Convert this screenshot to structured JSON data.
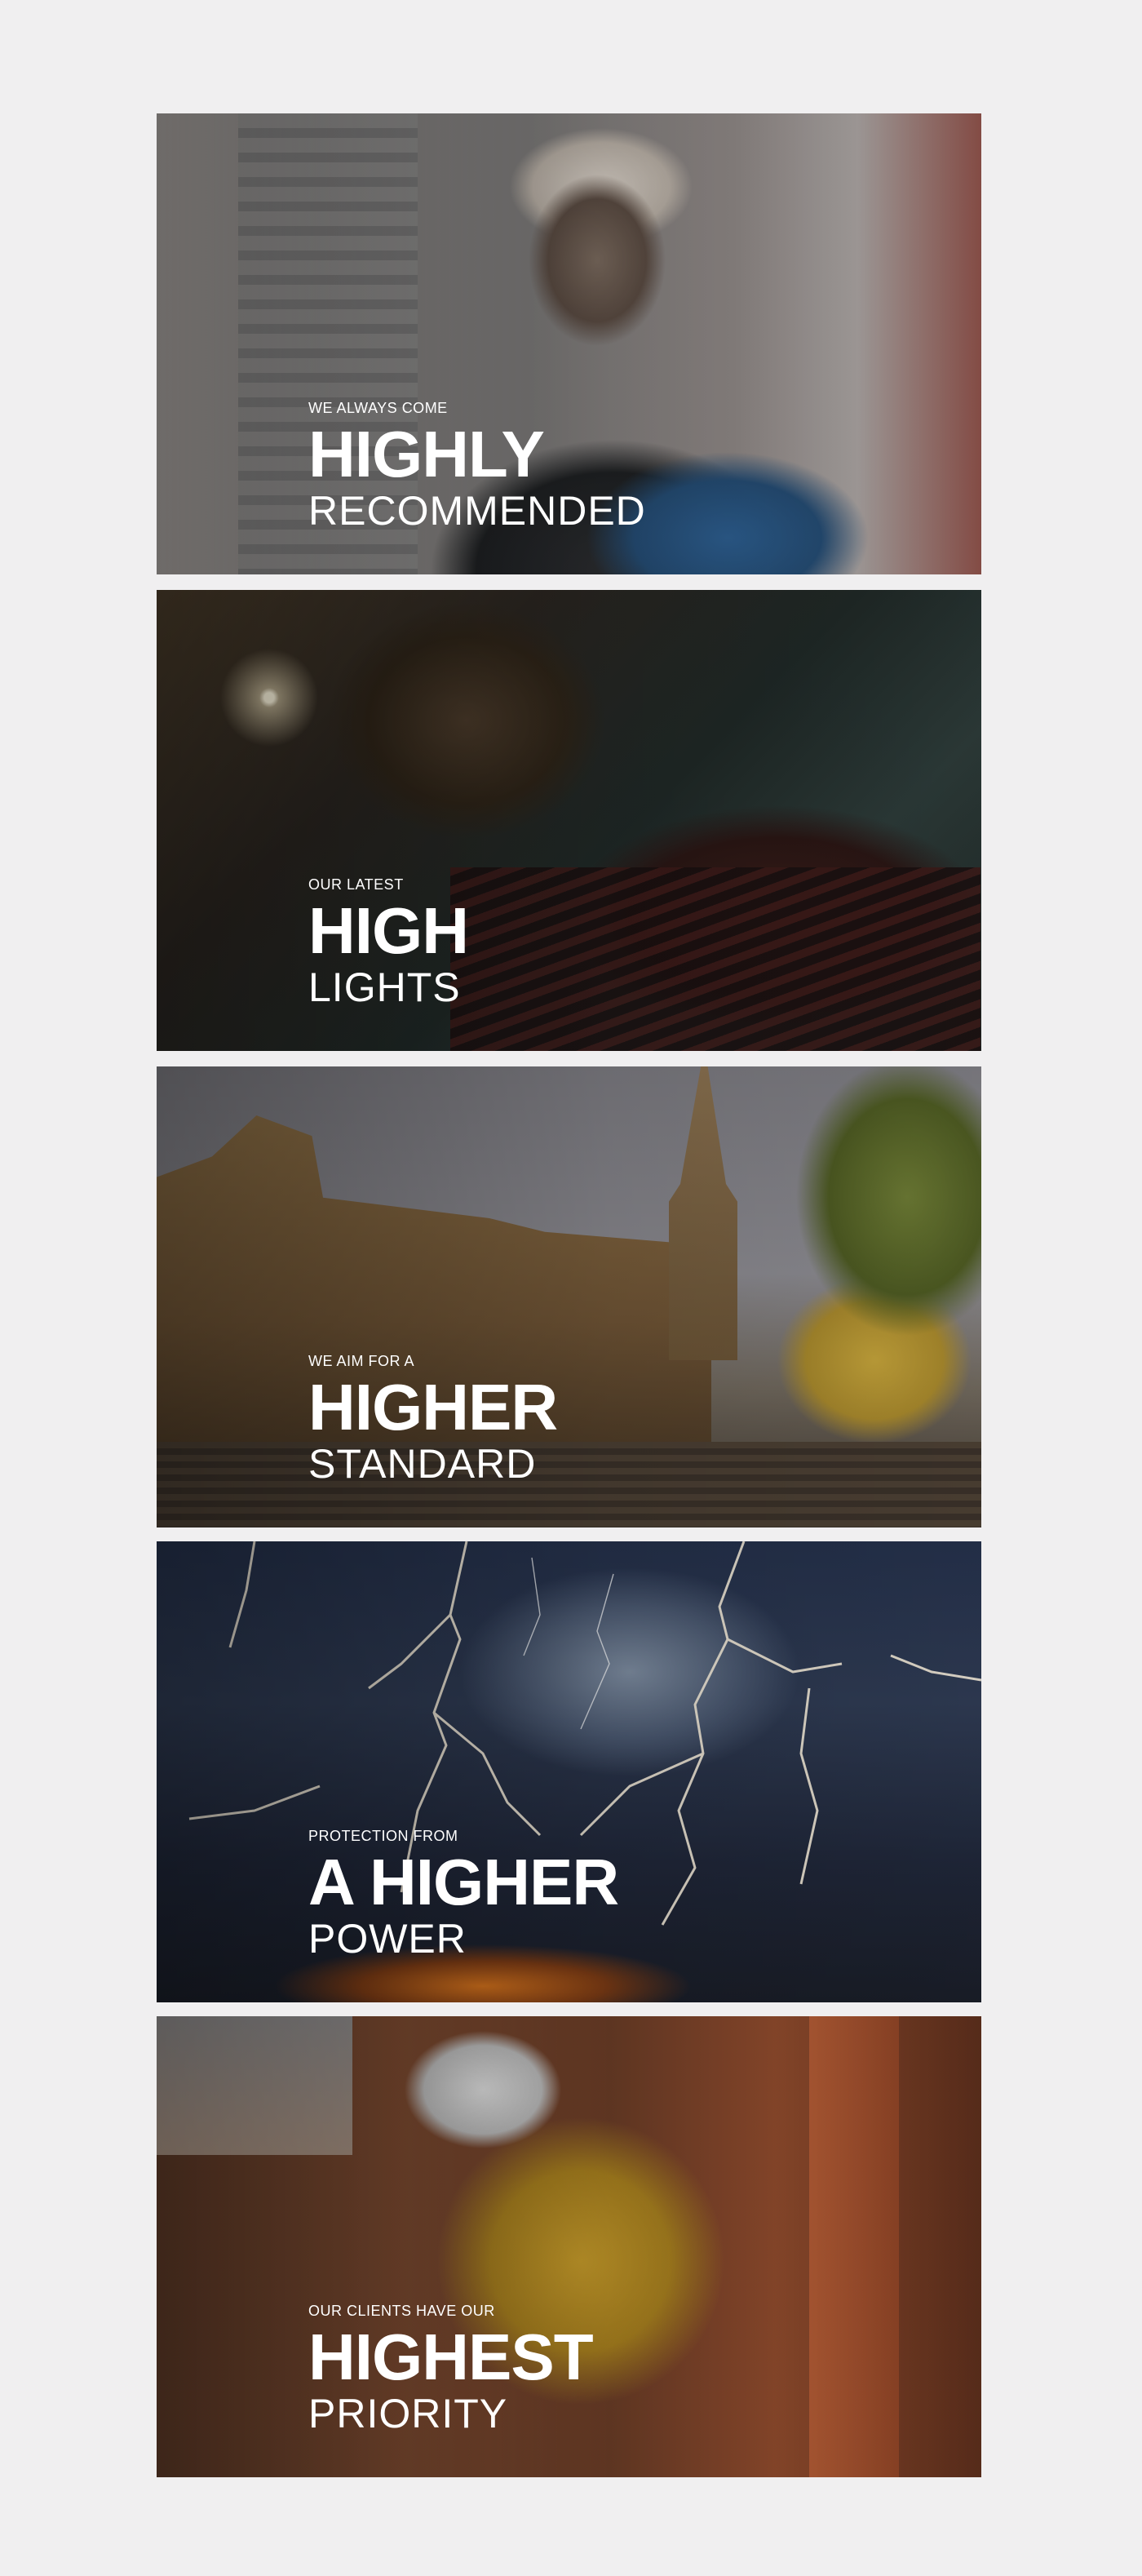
{
  "panels": [
    {
      "kicker": "WE ALWAYS COME",
      "headline": "HIGHLY",
      "sub": "RECOMMENDED"
    },
    {
      "kicker": "OUR LATEST",
      "headline": "HIGH",
      "sub": "LIGHTS"
    },
    {
      "kicker": "WE AIM FOR A",
      "headline": "HIGHER",
      "sub": "STANDARD"
    },
    {
      "kicker": "PROTECTION FROM",
      "headline": "A HIGHER",
      "sub": "POWER"
    },
    {
      "kicker": "OUR CLIENTS HAVE OUR",
      "headline": "HIGHEST",
      "sub": "PRIORITY"
    }
  ]
}
